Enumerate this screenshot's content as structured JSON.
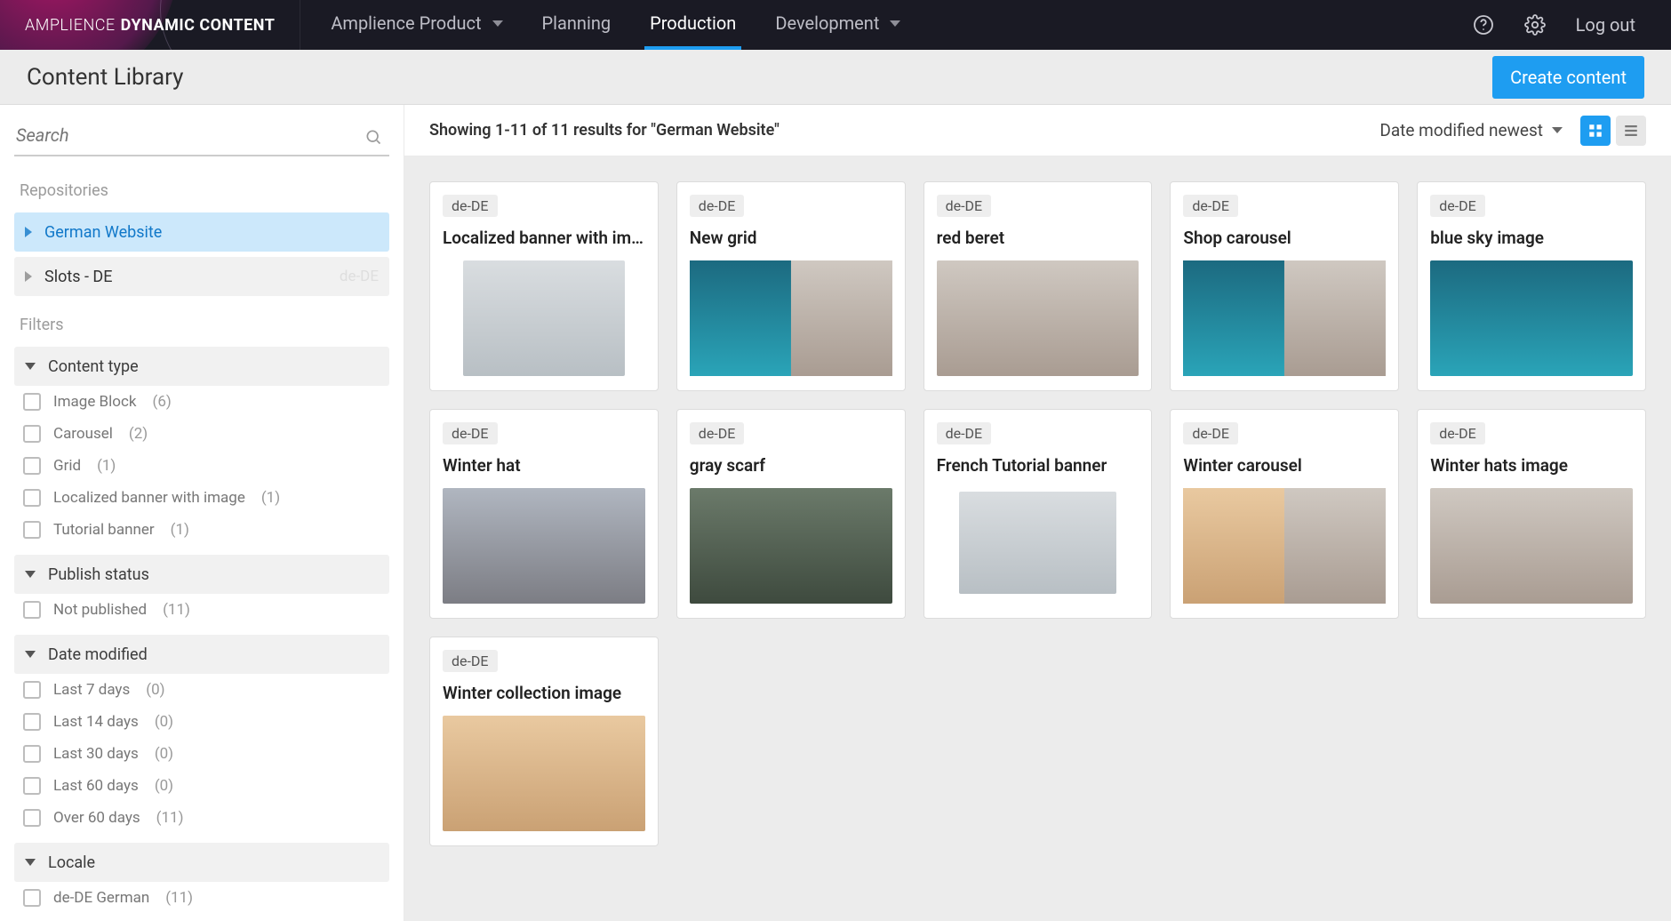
{
  "brand": {
    "thin": "AMPLIENCE",
    "bold": "DYNAMIC CONTENT"
  },
  "nav": {
    "product": "Amplience Product",
    "planning": "Planning",
    "production": "Production",
    "development": "Development",
    "logout": "Log out"
  },
  "header": {
    "title": "Content Library",
    "create": "Create content"
  },
  "search": {
    "placeholder": "Search"
  },
  "sidebar": {
    "repos_label": "Repositories",
    "filters_label": "Filters",
    "repos": [
      {
        "label": "German Website",
        "active": true
      },
      {
        "label": "Slots - DE",
        "ghost": "de-DE"
      }
    ],
    "content_type": {
      "title": "Content type",
      "items": [
        {
          "label": "Image Block",
          "count": "(6)"
        },
        {
          "label": "Carousel",
          "count": "(2)"
        },
        {
          "label": "Grid",
          "count": "(1)"
        },
        {
          "label": "Localized banner with image",
          "count": "(1)"
        },
        {
          "label": "Tutorial banner",
          "count": "(1)"
        }
      ]
    },
    "publish_status": {
      "title": "Publish status",
      "items": [
        {
          "label": "Not published",
          "count": "(11)"
        }
      ]
    },
    "date_modified": {
      "title": "Date modified",
      "items": [
        {
          "label": "Last 7 days",
          "count": "(0)"
        },
        {
          "label": "Last 14 days",
          "count": "(0)"
        },
        {
          "label": "Last 30 days",
          "count": "(0)"
        },
        {
          "label": "Last 60 days",
          "count": "(0)"
        },
        {
          "label": "Over 60 days",
          "count": "(11)"
        }
      ]
    },
    "locale": {
      "title": "Locale",
      "items": [
        {
          "label": "de-DE German",
          "count": "(11)"
        }
      ]
    }
  },
  "toolbar": {
    "results": "Showing 1-11 of 11 results for \"German Website\"",
    "sort": "Date modified newest"
  },
  "cards": [
    {
      "locale": "de-DE",
      "title": "Localized banner with im…"
    },
    {
      "locale": "de-DE",
      "title": "New grid"
    },
    {
      "locale": "de-DE",
      "title": "red beret"
    },
    {
      "locale": "de-DE",
      "title": "Shop carousel"
    },
    {
      "locale": "de-DE",
      "title": "blue sky image"
    },
    {
      "locale": "de-DE",
      "title": "Winter hat"
    },
    {
      "locale": "de-DE",
      "title": "gray scarf"
    },
    {
      "locale": "de-DE",
      "title": "French Tutorial banner"
    },
    {
      "locale": "de-DE",
      "title": "Winter carousel"
    },
    {
      "locale": "de-DE",
      "title": "Winter hats image"
    },
    {
      "locale": "de-DE",
      "title": "Winter collection image"
    }
  ]
}
